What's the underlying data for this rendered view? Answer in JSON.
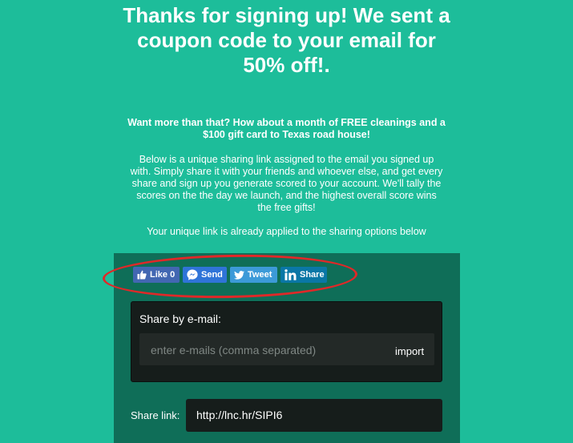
{
  "headline": {
    "line1": "Thanks for signing up! We sent a",
    "line2": "coupon code to your email for",
    "line3": "50% off!."
  },
  "lead": {
    "line1": "Want more than that? How about a month of FREE cleanings and a",
    "line2": "$100 gift card to Texas road house!"
  },
  "body": {
    "line1": "Below is a unique sharing link assigned to the email you signed up",
    "line2": "with. Simply share it with your friends and whoever else, and get every",
    "line3": "share and sign up you generate scored to your account. We'll tally the",
    "line4": "scores on the the day we launch, and the highest overall score wins",
    "line5": "the free gifts!"
  },
  "link_note": "Your unique link is already applied to the sharing options below",
  "share_buttons": {
    "facebook": {
      "label": "Like 0",
      "icon": "thumbs-up-icon"
    },
    "messenger": {
      "label": "Send",
      "icon": "messenger-icon"
    },
    "twitter": {
      "label": "Tweet",
      "icon": "twitter-bird-icon"
    },
    "linkedin": {
      "label": "Share",
      "icon": "linkedin-icon"
    }
  },
  "email_share": {
    "label": "Share by e-mail:",
    "placeholder": "enter e-mails (comma separated)",
    "import_label": "import"
  },
  "share_link": {
    "label": "Share link:",
    "value": "http://lnc.hr/SIPI6"
  },
  "colors": {
    "background": "#1dbd9a",
    "panel": "#0f6e58",
    "highlight": "#e02828",
    "facebook": "#4267b2",
    "messenger": "#2f74d8",
    "twitter": "#3c9ad8",
    "linkedin": "#0a77a6"
  }
}
